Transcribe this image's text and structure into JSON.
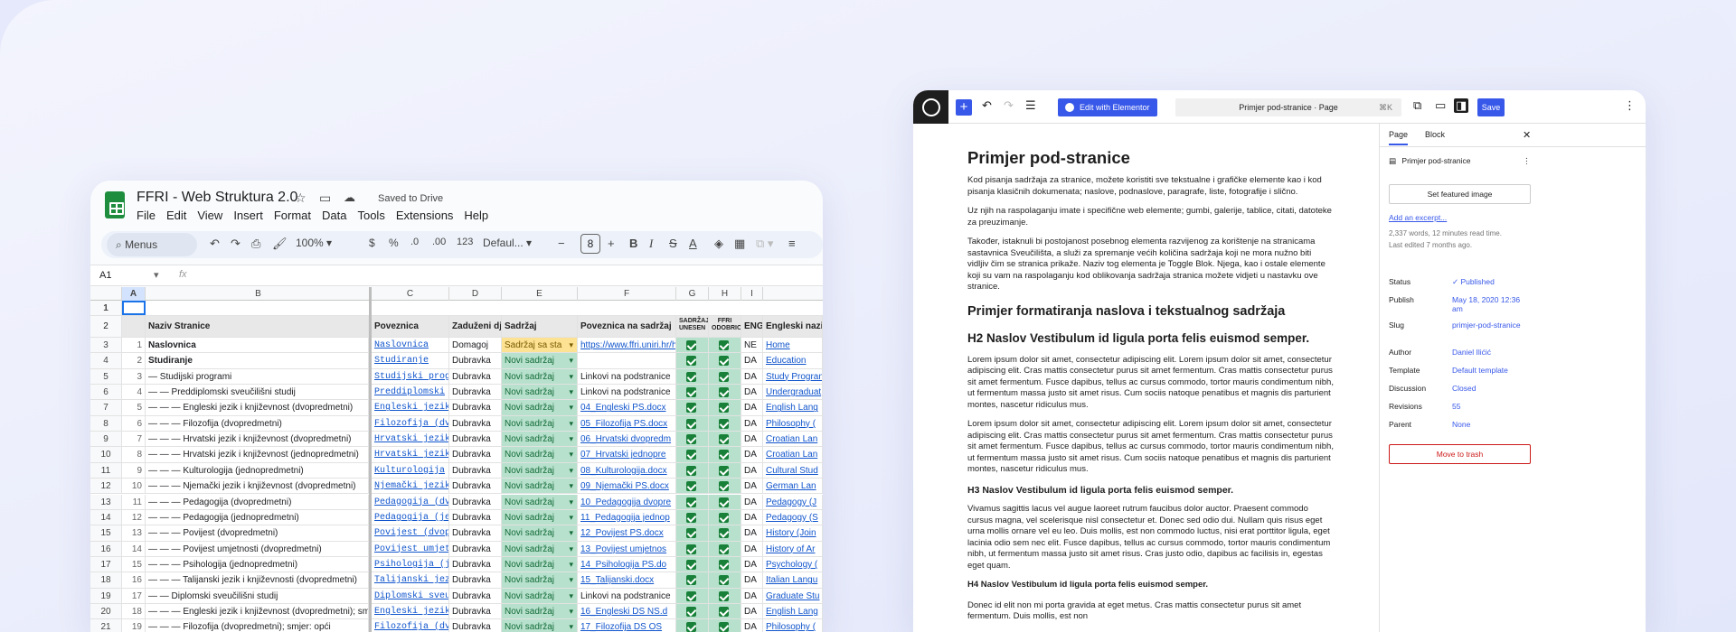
{
  "sheets": {
    "title": "FFRI - Web Struktura 2.0",
    "saved": "Saved to Drive",
    "menu": [
      "File",
      "Edit",
      "View",
      "Insert",
      "Format",
      "Data",
      "Tools",
      "Extensions",
      "Help"
    ],
    "toolbar": {
      "search": "Menus",
      "zoom": "100%",
      "currency": "$",
      "percent": "%",
      "dec_dec": ".0",
      "dec_inc": ".00",
      "num_format": "123",
      "font": "Defaul...",
      "font_size": "8"
    },
    "cell_ref": "A1",
    "fx": "fx",
    "columns": [
      "A",
      "B",
      "C",
      "D",
      "E",
      "F",
      "G",
      "H",
      "I"
    ],
    "col_g_header": "SADRŽAJ UNESEN",
    "col_h_header": "FFRI ODOBRIO",
    "header": {
      "n": "2",
      "b": "Naziv Stranice",
      "c": "Poveznica",
      "d": "Zaduženi djel",
      "e": "Sadržaj",
      "f": "Poveznica na sadržaj",
      "i": "ENG",
      "j": "Engleski naziv"
    },
    "rows": [
      {
        "n": "3",
        "a": "1",
        "b": "Naslovnica",
        "bold": true,
        "c": "Naslovnica",
        "d": "Domagoj",
        "e": "Sadržaj sa sta",
        "ey": true,
        "f": "https://www.ffri.uniri.hr/hr",
        "flink": true,
        "i": "NE",
        "j": "Home"
      },
      {
        "n": "4",
        "a": "2",
        "b": "Studiranje",
        "bold": true,
        "c": "Studiranje",
        "d": "Dubravka",
        "e": "Novi sadržaj",
        "f": "",
        "i": "DA",
        "j": "Education"
      },
      {
        "n": "5",
        "a": "3",
        "b": "— Studijski programi",
        "c": "Studijski prog",
        "d": "Dubravka",
        "e": "Novi sadržaj",
        "f": "Linkovi na podstranice",
        "i": "DA",
        "j": "Study Program"
      },
      {
        "n": "6",
        "a": "4",
        "b": "— — Preddiplomski sveučilišni studij",
        "c": "Preddiplomski",
        "d": "Dubravka",
        "e": "Novi sadržaj",
        "f": "Linkovi na podstranice",
        "i": "DA",
        "j": "Undergraduat"
      },
      {
        "n": "7",
        "a": "5",
        "b": "— — — Engleski jezik i književnost (dvopredmetni)",
        "c": "Engleski jezik",
        "d": "Dubravka",
        "e": "Novi sadržaj",
        "f": "04_Engleski PS.docx",
        "flink": true,
        "i": "DA",
        "j": "English Lang"
      },
      {
        "n": "8",
        "a": "6",
        "b": "— — — Filozofija (dvopredmetni)",
        "c": "Filozofija (dv",
        "d": "Dubravka",
        "e": "Novi sadržaj",
        "f": "05_Filozofija PS.docx",
        "flink": true,
        "i": "DA",
        "j": "Philosophy ("
      },
      {
        "n": "9",
        "a": "7",
        "b": "— — — Hrvatski jezik i književnost (dvopredmetni)",
        "c": "Hrvatski jezik",
        "d": "Dubravka",
        "e": "Novi sadržaj",
        "f": "06_Hrvatski dvopredm",
        "flink": true,
        "i": "DA",
        "j": "Croatian Lan"
      },
      {
        "n": "10",
        "a": "8",
        "b": "— — — Hrvatski jezik i književnost (jednopredmetni)",
        "c": "Hrvatski jezik",
        "d": "Dubravka",
        "e": "Novi sadržaj",
        "f": "07_Hrvatski jednopre",
        "flink": true,
        "i": "DA",
        "j": "Croatian Lan"
      },
      {
        "n": "11",
        "a": "9",
        "b": "— — — Kulturologija (jednopredmetni)",
        "c": "Kulturologija",
        "d": "Dubravka",
        "e": "Novi sadržaj",
        "f": "08_Kulturologija.docx",
        "flink": true,
        "i": "DA",
        "j": "Cultural Stud"
      },
      {
        "n": "12",
        "a": "10",
        "b": "— — — Njemački jezik i književnost (dvopredmetni)",
        "c": "Njemački jezik",
        "d": "Dubravka",
        "e": "Novi sadržaj",
        "f": "09_Njemački PS.docx",
        "flink": true,
        "i": "DA",
        "j": "German Lan"
      },
      {
        "n": "13",
        "a": "11",
        "b": "— — — Pedagogija (dvopredmetni)",
        "c": "Pedagogija (dv",
        "d": "Dubravka",
        "e": "Novi sadržaj",
        "f": "10_Pedagogija dvopre",
        "flink": true,
        "i": "DA",
        "j": "Pedagogy (J"
      },
      {
        "n": "14",
        "a": "12",
        "b": "— — — Pedagogija (jednopredmetni)",
        "c": "Pedagogija (je",
        "d": "Dubravka",
        "e": "Novi sadržaj",
        "f": "11_Pedagogija jednop",
        "flink": true,
        "i": "DA",
        "j": "Pedagogy (S"
      },
      {
        "n": "15",
        "a": "13",
        "b": "— — — Povijest (dvopredmetni)",
        "c": "Povijest (dvop",
        "d": "Dubravka",
        "e": "Novi sadržaj",
        "f": "12_Povijest PS.docx",
        "flink": true,
        "i": "DA",
        "j": "History (Join"
      },
      {
        "n": "16",
        "a": "14",
        "b": "— — — Povijest umjetnosti (dvopredmetni)",
        "c": "Povijest umjet",
        "d": "Dubravka",
        "e": "Novi sadržaj",
        "f": "13_Povijest umjetnos",
        "flink": true,
        "i": "DA",
        "j": "History of Ar"
      },
      {
        "n": "17",
        "a": "15",
        "b": "— — — Psihologija (jednopredmetni)",
        "c": "Psihologija (j",
        "d": "Dubravka",
        "e": "Novi sadržaj",
        "f": "14_Psihologija PS.do",
        "flink": true,
        "i": "DA",
        "j": "Psychology ("
      },
      {
        "n": "18",
        "a": "16",
        "b": "— — — Talijanski jezik i književnosti (dvopredmetni)",
        "c": "Talijanski jez",
        "d": "Dubravka",
        "e": "Novi sadržaj",
        "f": "15_Talijanski.docx",
        "flink": true,
        "i": "DA",
        "j": "Italian Langu"
      },
      {
        "n": "19",
        "a": "17",
        "b": "— — Diplomski sveučilišni studij",
        "c": "Diplomski sveu",
        "d": "Dubravka",
        "e": "Novi sadržaj",
        "f": "Linkovi na podstranice",
        "i": "DA",
        "j": "Graduate Stu"
      },
      {
        "n": "20",
        "a": "18",
        "b": "— — — Engleski jezik i književnost (dvopredmetni); sm",
        "c": "Engleski jezik",
        "d": "Dubravka",
        "e": "Novi sadržaj",
        "f": "16_Engleski DS NS.d",
        "flink": true,
        "i": "DA",
        "j": "English Lang"
      },
      {
        "n": "21",
        "a": "19",
        "b": "— — — Filozofija (dvopredmetni); smjer: opći",
        "c": "Filozofija (dv",
        "d": "Dubravka",
        "e": "Novi sadržaj",
        "f": "17_Filozofija DS OS",
        "flink": true,
        "i": "DA",
        "j": "Philosophy ("
      }
    ]
  },
  "wp": {
    "elementor": "Edit with Elementor",
    "command": "Primjer pod-stranice · Page",
    "shortcut": "⌘K",
    "save": "Save",
    "title": "Primjer pod-stranice",
    "p1": "Kod pisanja sadržaja za stranice, možete koristiti sve tekstualne i grafičke elemente kao i kod pisanja klasičnih dokumenata; naslove, podnaslove, paragrafe, liste, fotografije i slično.",
    "p2": "Uz njih na raspolaganju imate i specifične web elemente; gumbi, galerije, tablice, citati, datoteke za preuzimanje.",
    "p3": "Također, istaknuli bi postojanost posebnog elementa razvijenog za korištenje na stranicama sastavnica Sveučilišta, a služi za spremanje većih količina sadržaja koji ne mora nužno biti vidljiv čim se stranica prikaže. Naziv tog elementa je Toggle Blok. Njega, kao i ostale elemente koji su vam na raspolaganju kod oblikovanja sadržaja stranica možete vidjeti u nastavku ove stranice.",
    "h2a": "Primjer formatiranja naslova i tekstualnog sadržaja",
    "h2b": "H2 Naslov Vestibulum id ligula porta felis euismod semper.",
    "lorem1": "Lorem ipsum dolor sit amet, consectetur adipiscing elit. Lorem ipsum dolor sit amet, consectetur adipiscing elit. Cras mattis consectetur purus sit amet fermentum. Cras mattis consectetur purus sit amet fermentum. Fusce dapibus, tellus ac cursus commodo, tortor mauris condimentum nibh, ut fermentum massa justo sit amet risus. Cum sociis natoque penatibus et magnis dis parturient montes, nascetur ridiculus mus.",
    "lorem2": "Lorem ipsum dolor sit amet, consectetur adipiscing elit. Lorem ipsum dolor sit amet, consectetur adipiscing elit. Cras mattis consectetur purus sit amet fermentum. Cras mattis consectetur purus sit amet fermentum. Fusce dapibus, tellus ac cursus commodo, tortor mauris condimentum nibh, ut fermentum massa justo sit amet risus. Cum sociis natoque penatibus et magnis dis parturient montes, nascetur ridiculus mus.",
    "h3": "H3 Naslov Vestibulum id ligula porta felis euismod semper.",
    "p4": "Vivamus sagittis lacus vel augue laoreet rutrum faucibus dolor auctor. Praesent commodo cursus magna, vel scelerisque nisl consectetur et. Donec sed odio dui. Nullam quis risus eget urna mollis ornare vel eu leo. Duis mollis, est non commodo luctus, nisi erat porttitor ligula, eget lacinia odio sem nec elit. Fusce dapibus, tellus ac cursus commodo, tortor mauris condimentum nibh, ut fermentum massa justo sit amet risus. Cras justo odio, dapibus ac facilisis in, egestas eget quam.",
    "h4": "H4 Naslov Vestibulum id ligula porta felis euismod semper.",
    "p5": "Donec id elit non mi porta gravida at eget metus. Cras mattis consectetur purus sit amet fermentum. Duis mollis, est non",
    "sidebar": {
      "tab_page": "Page",
      "tab_block": "Block",
      "page_name": "Primjer pod-stranice",
      "featured": "Set featured image",
      "excerpt": "Add an excerpt...",
      "stats": "2,337 words, 12 minutes read time.",
      "edited": "Last edited 7 months ago.",
      "status_k": "Status",
      "status_v": "Published",
      "publish_k": "Publish",
      "publish_v": "May 18, 2020 12:36 am",
      "slug_k": "Slug",
      "slug_v": "primjer-pod-stranice",
      "author_k": "Author",
      "author_v": "Daniel Ilićić",
      "template_k": "Template",
      "template_v": "Default template",
      "discussion_k": "Discussion",
      "discussion_v": "Closed",
      "revisions_k": "Revisions",
      "revisions_v": "55",
      "parent_k": "Parent",
      "parent_v": "None",
      "trash": "Move to trash"
    }
  }
}
